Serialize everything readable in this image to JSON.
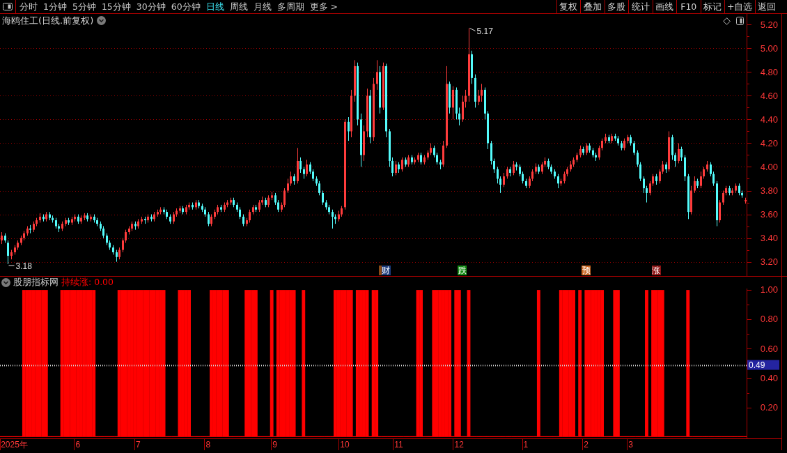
{
  "toolbar": {
    "periods": [
      {
        "label": "分时",
        "selected": false
      },
      {
        "label": "1分钟",
        "selected": false
      },
      {
        "label": "5分钟",
        "selected": false
      },
      {
        "label": "15分钟",
        "selected": false
      },
      {
        "label": "30分钟",
        "selected": false
      },
      {
        "label": "60分钟",
        "selected": false
      },
      {
        "label": "日线",
        "selected": true
      },
      {
        "label": "周线",
        "selected": false
      },
      {
        "label": "月线",
        "selected": false
      },
      {
        "label": "多周期",
        "selected": false
      },
      {
        "label": "更多 >",
        "selected": false
      }
    ],
    "actions": [
      "复权",
      "叠加",
      "多股",
      "统计",
      "画线",
      "F10",
      "标记",
      "+自选",
      "返回"
    ]
  },
  "price_pane": {
    "title": "海鸥住工(日线.前复权)",
    "events": [
      {
        "color": "#8b4a16"
      },
      {
        "label": "财",
        "color": "#1b3a7a"
      },
      {
        "label": "跌",
        "color": "#138a13"
      },
      {
        "label": "预",
        "color": "#c8641e"
      },
      {
        "label": "涨",
        "color": "#8c1414"
      }
    ],
    "chart_data": {
      "type": "candlestick",
      "ylim": [
        3.08,
        5.29
      ],
      "grid": true,
      "yticks": [
        {
          "value": 5.2,
          "label": "5.20"
        },
        {
          "value": 5.0,
          "label": "5.00"
        },
        {
          "value": 4.8,
          "label": "4.80"
        },
        {
          "value": 4.6,
          "label": "4.60"
        },
        {
          "value": 4.4,
          "label": "4.40"
        },
        {
          "value": 4.2,
          "label": "4.20"
        },
        {
          "value": 4.0,
          "label": "4.00"
        },
        {
          "value": 3.8,
          "label": "3.80"
        },
        {
          "value": 3.6,
          "label": "3.60"
        },
        {
          "value": 3.4,
          "label": "3.40"
        },
        {
          "value": 3.2,
          "label": "3.20"
        }
      ],
      "annotations": [
        "5.17",
        "3.18"
      ],
      "ohlc": [
        [
          3.38,
          3.45,
          3.35,
          3.42
        ],
        [
          3.42,
          3.44,
          3.36,
          3.38
        ],
        [
          3.36,
          3.38,
          3.18,
          3.25
        ],
        [
          3.25,
          3.3,
          3.22,
          3.28
        ],
        [
          3.28,
          3.34,
          3.26,
          3.32
        ],
        [
          3.32,
          3.38,
          3.3,
          3.36
        ],
        [
          3.36,
          3.42,
          3.34,
          3.4
        ],
        [
          3.4,
          3.46,
          3.38,
          3.44
        ],
        [
          3.44,
          3.5,
          3.42,
          3.48
        ],
        [
          3.48,
          3.51,
          3.44,
          3.47
        ],
        [
          3.47,
          3.54,
          3.45,
          3.52
        ],
        [
          3.52,
          3.57,
          3.5,
          3.55
        ],
        [
          3.55,
          3.61,
          3.53,
          3.58
        ],
        [
          3.58,
          3.6,
          3.54,
          3.56
        ],
        [
          3.56,
          3.62,
          3.54,
          3.6
        ],
        [
          3.6,
          3.62,
          3.55,
          3.57
        ],
        [
          3.57,
          3.59,
          3.53,
          3.55
        ],
        [
          3.55,
          3.57,
          3.48,
          3.5
        ],
        [
          3.5,
          3.52,
          3.45,
          3.48
        ],
        [
          3.48,
          3.54,
          3.46,
          3.52
        ],
        [
          3.52,
          3.57,
          3.5,
          3.55
        ],
        [
          3.55,
          3.57,
          3.51,
          3.53
        ],
        [
          3.53,
          3.58,
          3.51,
          3.56
        ],
        [
          3.56,
          3.6,
          3.54,
          3.58
        ],
        [
          3.58,
          3.6,
          3.52,
          3.54
        ],
        [
          3.54,
          3.59,
          3.52,
          3.57
        ],
        [
          3.57,
          3.61,
          3.55,
          3.59
        ],
        [
          3.59,
          3.61,
          3.54,
          3.56
        ],
        [
          3.56,
          3.6,
          3.54,
          3.58
        ],
        [
          3.58,
          3.6,
          3.53,
          3.55
        ],
        [
          3.55,
          3.57,
          3.5,
          3.52
        ],
        [
          3.52,
          3.54,
          3.46,
          3.48
        ],
        [
          3.48,
          3.5,
          3.4,
          3.42
        ],
        [
          3.42,
          3.44,
          3.34,
          3.36
        ],
        [
          3.36,
          3.38,
          3.3,
          3.32
        ],
        [
          3.32,
          3.34,
          3.26,
          3.28
        ],
        [
          3.28,
          3.3,
          3.2,
          3.24
        ],
        [
          3.24,
          3.32,
          3.22,
          3.3
        ],
        [
          3.3,
          3.4,
          3.28,
          3.38
        ],
        [
          3.38,
          3.47,
          3.36,
          3.45
        ],
        [
          3.45,
          3.5,
          3.43,
          3.48
        ],
        [
          3.48,
          3.54,
          3.46,
          3.52
        ],
        [
          3.52,
          3.54,
          3.47,
          3.5
        ],
        [
          3.5,
          3.56,
          3.48,
          3.54
        ],
        [
          3.54,
          3.58,
          3.52,
          3.56
        ],
        [
          3.56,
          3.58,
          3.52,
          3.55
        ],
        [
          3.55,
          3.6,
          3.53,
          3.58
        ],
        [
          3.58,
          3.6,
          3.54,
          3.56
        ],
        [
          3.56,
          3.62,
          3.54,
          3.6
        ],
        [
          3.6,
          3.64,
          3.58,
          3.62
        ],
        [
          3.62,
          3.66,
          3.6,
          3.64
        ],
        [
          3.64,
          3.66,
          3.6,
          3.62
        ],
        [
          3.62,
          3.64,
          3.56,
          3.58
        ],
        [
          3.58,
          3.6,
          3.52,
          3.54
        ],
        [
          3.54,
          3.62,
          3.52,
          3.6
        ],
        [
          3.6,
          3.65,
          3.58,
          3.63
        ],
        [
          3.63,
          3.67,
          3.61,
          3.65
        ],
        [
          3.65,
          3.67,
          3.6,
          3.62
        ],
        [
          3.62,
          3.68,
          3.6,
          3.66
        ],
        [
          3.66,
          3.7,
          3.64,
          3.68
        ],
        [
          3.68,
          3.7,
          3.64,
          3.66
        ],
        [
          3.66,
          3.72,
          3.64,
          3.7
        ],
        [
          3.7,
          3.72,
          3.65,
          3.67
        ],
        [
          3.67,
          3.69,
          3.62,
          3.64
        ],
        [
          3.64,
          3.66,
          3.58,
          3.6
        ],
        [
          3.6,
          3.62,
          3.5,
          3.52
        ],
        [
          3.52,
          3.6,
          3.5,
          3.58
        ],
        [
          3.58,
          3.64,
          3.56,
          3.62
        ],
        [
          3.62,
          3.68,
          3.6,
          3.66
        ],
        [
          3.66,
          3.68,
          3.62,
          3.64
        ],
        [
          3.64,
          3.7,
          3.62,
          3.68
        ],
        [
          3.68,
          3.72,
          3.66,
          3.7
        ],
        [
          3.7,
          3.74,
          3.68,
          3.72
        ],
        [
          3.72,
          3.74,
          3.66,
          3.68
        ],
        [
          3.68,
          3.7,
          3.62,
          3.64
        ],
        [
          3.64,
          3.66,
          3.56,
          3.58
        ],
        [
          3.58,
          3.6,
          3.5,
          3.52
        ],
        [
          3.52,
          3.57,
          3.5,
          3.55
        ],
        [
          3.55,
          3.64,
          3.53,
          3.62
        ],
        [
          3.62,
          3.68,
          3.6,
          3.66
        ],
        [
          3.66,
          3.68,
          3.62,
          3.64
        ],
        [
          3.64,
          3.72,
          3.62,
          3.7
        ],
        [
          3.7,
          3.75,
          3.68,
          3.72
        ],
        [
          3.72,
          3.74,
          3.66,
          3.68
        ],
        [
          3.68,
          3.76,
          3.66,
          3.74
        ],
        [
          3.74,
          3.79,
          3.72,
          3.76
        ],
        [
          3.76,
          3.78,
          3.68,
          3.7
        ],
        [
          3.7,
          3.72,
          3.62,
          3.64
        ],
        [
          3.64,
          3.7,
          3.62,
          3.68
        ],
        [
          3.68,
          3.82,
          3.66,
          3.8
        ],
        [
          3.8,
          3.9,
          3.78,
          3.86
        ],
        [
          3.86,
          3.96,
          3.84,
          3.92
        ],
        [
          3.92,
          3.94,
          3.85,
          3.88
        ],
        [
          3.88,
          4.16,
          3.86,
          4.05
        ],
        [
          4.05,
          4.08,
          3.95,
          3.98
        ],
        [
          3.98,
          4.0,
          3.9,
          3.94
        ],
        [
          3.94,
          4.06,
          3.92,
          4.02
        ],
        [
          4.02,
          4.04,
          3.94,
          3.96
        ],
        [
          3.96,
          3.98,
          3.88,
          3.9
        ],
        [
          3.9,
          3.92,
          3.84,
          3.86
        ],
        [
          3.86,
          3.88,
          3.76,
          3.78
        ],
        [
          3.78,
          3.8,
          3.68,
          3.7
        ],
        [
          3.7,
          3.72,
          3.64,
          3.66
        ],
        [
          3.66,
          3.68,
          3.6,
          3.62
        ],
        [
          3.62,
          3.64,
          3.48,
          3.58
        ],
        [
          3.58,
          3.6,
          3.52,
          3.56
        ],
        [
          3.56,
          3.63,
          3.54,
          3.6
        ],
        [
          3.6,
          3.67,
          3.58,
          3.65
        ],
        [
          3.66,
          4.4,
          3.64,
          4.38
        ],
        [
          4.38,
          4.42,
          4.22,
          4.3
        ],
        [
          4.3,
          4.65,
          4.25,
          4.6
        ],
        [
          4.6,
          4.9,
          4.55,
          4.85
        ],
        [
          4.85,
          4.88,
          4.35,
          4.4
        ],
        [
          4.4,
          4.45,
          4.0,
          4.1
        ],
        [
          4.1,
          4.35,
          4.05,
          4.3
        ],
        [
          4.3,
          4.66,
          4.25,
          4.6
        ],
        [
          4.6,
          4.65,
          4.2,
          4.25
        ],
        [
          4.25,
          4.75,
          4.22,
          4.7
        ],
        [
          4.7,
          4.9,
          4.65,
          4.8
        ],
        [
          4.8,
          4.85,
          4.45,
          4.5
        ],
        [
          4.5,
          4.88,
          4.48,
          4.85
        ],
        [
          4.85,
          4.87,
          4.25,
          4.3
        ],
        [
          4.3,
          4.32,
          4.0,
          4.05
        ],
        [
          4.05,
          4.08,
          3.92,
          3.95
        ],
        [
          3.95,
          4.05,
          3.93,
          4.02
        ],
        [
          4.02,
          4.04,
          3.95,
          3.98
        ],
        [
          3.98,
          4.08,
          3.96,
          4.06
        ],
        [
          4.06,
          4.08,
          4.0,
          4.02
        ],
        [
          4.02,
          4.1,
          4.0,
          4.08
        ],
        [
          4.08,
          4.1,
          4.02,
          4.04
        ],
        [
          4.04,
          4.08,
          4.02,
          4.06
        ],
        [
          4.06,
          4.12,
          4.04,
          4.1
        ],
        [
          4.1,
          4.12,
          4.02,
          4.04
        ],
        [
          4.04,
          4.1,
          4.02,
          4.08
        ],
        [
          4.08,
          4.14,
          4.06,
          4.12
        ],
        [
          4.12,
          4.2,
          4.1,
          4.16
        ],
        [
          4.16,
          4.18,
          4.08,
          4.1
        ],
        [
          4.1,
          4.12,
          4.02,
          4.04
        ],
        [
          4.04,
          4.06,
          3.98,
          4.02
        ],
        [
          4.02,
          4.22,
          4.0,
          4.18
        ],
        [
          4.18,
          4.85,
          4.16,
          4.7
        ],
        [
          4.7,
          4.72,
          4.45,
          4.5
        ],
        [
          4.5,
          4.68,
          4.4,
          4.65
        ],
        [
          4.65,
          4.67,
          4.4,
          4.45
        ],
        [
          4.45,
          4.5,
          4.35,
          4.4
        ],
        [
          4.4,
          4.6,
          4.38,
          4.55
        ],
        [
          4.55,
          4.65,
          4.5,
          4.6
        ],
        [
          4.6,
          5.17,
          4.55,
          4.95
        ],
        [
          4.95,
          4.98,
          4.7,
          4.75
        ],
        [
          4.75,
          4.78,
          4.5,
          4.55
        ],
        [
          4.55,
          4.65,
          4.52,
          4.6
        ],
        [
          4.6,
          4.7,
          4.55,
          4.65
        ],
        [
          4.65,
          4.67,
          4.4,
          4.45
        ],
        [
          4.45,
          4.47,
          4.15,
          4.2
        ],
        [
          4.2,
          4.22,
          4.02,
          4.05
        ],
        [
          4.05,
          4.07,
          3.95,
          3.98
        ],
        [
          3.98,
          4.0,
          3.86,
          3.9
        ],
        [
          3.9,
          3.92,
          3.78,
          3.85
        ],
        [
          3.85,
          3.95,
          3.83,
          3.92
        ],
        [
          3.92,
          4.0,
          3.9,
          3.98
        ],
        [
          3.98,
          4.0,
          3.92,
          3.95
        ],
        [
          3.95,
          4.05,
          3.93,
          4.02
        ],
        [
          4.02,
          4.04,
          3.97,
          4.0
        ],
        [
          4.0,
          4.02,
          3.92,
          3.94
        ],
        [
          3.94,
          3.96,
          3.86,
          3.88
        ],
        [
          3.88,
          3.9,
          3.82,
          3.84
        ],
        [
          3.84,
          3.92,
          3.82,
          3.9
        ],
        [
          3.9,
          3.98,
          3.88,
          3.96
        ],
        [
          3.96,
          4.03,
          3.94,
          4.0
        ],
        [
          4.0,
          4.02,
          3.94,
          3.96
        ],
        [
          3.96,
          4.04,
          3.94,
          4.02
        ],
        [
          4.02,
          4.08,
          4.0,
          4.05
        ],
        [
          4.05,
          4.07,
          3.98,
          4.0
        ],
        [
          4.0,
          4.02,
          3.94,
          3.96
        ],
        [
          3.96,
          3.98,
          3.9,
          3.92
        ],
        [
          3.92,
          3.94,
          3.82,
          3.86
        ],
        [
          3.86,
          3.9,
          3.84,
          3.88
        ],
        [
          3.88,
          3.96,
          3.86,
          3.94
        ],
        [
          3.94,
          4.0,
          3.92,
          3.98
        ],
        [
          3.98,
          4.05,
          3.96,
          4.02
        ],
        [
          4.02,
          4.08,
          4.0,
          4.06
        ],
        [
          4.06,
          4.12,
          4.04,
          4.1
        ],
        [
          4.1,
          4.18,
          4.08,
          4.15
        ],
        [
          4.15,
          4.17,
          4.1,
          4.12
        ],
        [
          4.12,
          4.2,
          4.1,
          4.18
        ],
        [
          4.18,
          4.2,
          4.12,
          4.14
        ],
        [
          4.14,
          4.16,
          4.08,
          4.1
        ],
        [
          4.1,
          4.12,
          4.05,
          4.08
        ],
        [
          4.08,
          4.18,
          4.06,
          4.16
        ],
        [
          4.16,
          4.24,
          4.14,
          4.22
        ],
        [
          4.22,
          4.28,
          4.2,
          4.25
        ],
        [
          4.25,
          4.27,
          4.2,
          4.22
        ],
        [
          4.22,
          4.28,
          4.2,
          4.26
        ],
        [
          4.26,
          4.28,
          4.22,
          4.24
        ],
        [
          4.24,
          4.26,
          4.18,
          4.2
        ],
        [
          4.2,
          4.22,
          4.14,
          4.16
        ],
        [
          4.16,
          4.24,
          4.14,
          4.22
        ],
        [
          4.22,
          4.27,
          4.2,
          4.25
        ],
        [
          4.25,
          4.27,
          4.18,
          4.2
        ],
        [
          4.2,
          4.22,
          4.1,
          4.12
        ],
        [
          4.12,
          4.14,
          4.0,
          4.02
        ],
        [
          4.02,
          4.04,
          3.88,
          3.9
        ],
        [
          3.9,
          3.92,
          3.78,
          3.82
        ],
        [
          3.82,
          3.84,
          3.7,
          3.78
        ],
        [
          3.78,
          3.88,
          3.76,
          3.86
        ],
        [
          3.86,
          3.94,
          3.84,
          3.92
        ],
        [
          3.92,
          3.94,
          3.85,
          3.88
        ],
        [
          3.88,
          3.98,
          3.86,
          3.96
        ],
        [
          3.96,
          4.05,
          3.94,
          4.02
        ],
        [
          4.02,
          4.04,
          3.95,
          3.98
        ],
        [
          3.98,
          4.3,
          3.96,
          4.25
        ],
        [
          4.25,
          4.27,
          4.06,
          4.1
        ],
        [
          4.1,
          4.12,
          4.0,
          4.05
        ],
        [
          4.05,
          4.2,
          4.03,
          4.15
        ],
        [
          4.15,
          4.17,
          4.05,
          4.08
        ],
        [
          4.08,
          4.1,
          3.88,
          3.92
        ],
        [
          3.92,
          3.94,
          3.56,
          3.62
        ],
        [
          3.62,
          3.84,
          3.6,
          3.8
        ],
        [
          3.8,
          3.92,
          3.78,
          3.88
        ],
        [
          3.88,
          3.9,
          3.82,
          3.84
        ],
        [
          3.84,
          3.96,
          3.82,
          3.92
        ],
        [
          3.92,
          4.0,
          3.9,
          3.98
        ],
        [
          3.98,
          4.05,
          3.96,
          4.02
        ],
        [
          4.02,
          4.04,
          3.92,
          3.94
        ],
        [
          3.94,
          3.96,
          3.84,
          3.86
        ],
        [
          3.86,
          3.88,
          3.5,
          3.55
        ],
        [
          3.55,
          3.72,
          3.53,
          3.7
        ],
        [
          3.7,
          3.8,
          3.68,
          3.78
        ],
        [
          3.78,
          3.84,
          3.76,
          3.82
        ],
        [
          3.82,
          3.84,
          3.76,
          3.78
        ],
        [
          3.78,
          3.82,
          3.76,
          3.8
        ],
        [
          3.8,
          3.86,
          3.78,
          3.84
        ],
        [
          3.84,
          3.86,
          3.76,
          3.78
        ],
        [
          3.78,
          3.8,
          3.74,
          3.76
        ],
        [
          3.71,
          3.74,
          3.69,
          3.72
        ]
      ]
    }
  },
  "indicator_pane": {
    "title": "股朋指标网",
    "readout": "持续涨: 0.00",
    "chart_data": {
      "type": "bar",
      "ylim": [
        -0.01,
        1.01
      ],
      "color": "#ff0000",
      "yticks": [
        {
          "value": 1.0,
          "label": "1.00"
        },
        {
          "value": 0.8,
          "label": "0.80"
        },
        {
          "value": 0.6,
          "label": "0.60"
        },
        {
          "value": 0.4,
          "label": "0.40"
        },
        {
          "value": 0.2,
          "label": "0.20"
        }
      ],
      "ref_lines": [
        {
          "axis": "y",
          "value": 0.49,
          "label": "0.49",
          "color": "#d8d8d8",
          "line_style": "dashed"
        }
      ],
      "categories": [
        null,
        null,
        null,
        null,
        "2025年",
        null,
        null,
        null,
        null,
        null,
        null,
        null,
        null,
        null,
        null,
        null,
        null,
        null,
        null,
        null,
        null,
        null,
        null,
        null,
        "6",
        null,
        null,
        null,
        null,
        null,
        null,
        null,
        null,
        null,
        null,
        null,
        null,
        null,
        null,
        null,
        null,
        null,
        null,
        "7",
        null,
        null,
        null,
        null,
        null,
        null,
        null,
        null,
        null,
        null,
        null,
        null,
        null,
        null,
        null,
        null,
        null,
        null,
        null,
        null,
        null,
        "8",
        null,
        null,
        null,
        null,
        null,
        null,
        null,
        null,
        null,
        null,
        null,
        null,
        null,
        null,
        null,
        null,
        null,
        null,
        null,
        null,
        "9",
        null,
        null,
        null,
        null,
        null,
        null,
        null,
        null,
        null,
        null,
        null,
        null,
        null,
        null,
        null,
        null,
        null,
        null,
        null,
        null,
        null,
        "10",
        null,
        null,
        null,
        null,
        null,
        null,
        null,
        null,
        null,
        null,
        null,
        null,
        null,
        null,
        null,
        null,
        "11",
        null,
        null,
        null,
        null,
        null,
        null,
        null,
        null,
        null,
        null,
        null,
        null,
        null,
        null,
        null,
        null,
        null,
        null,
        "12",
        null,
        null,
        null,
        null,
        null,
        null,
        null,
        null,
        null,
        null,
        null,
        null,
        null,
        null,
        null,
        null,
        null,
        null,
        null,
        null,
        "1",
        null,
        null,
        null,
        null,
        null,
        null,
        null,
        null,
        null,
        null,
        null,
        null,
        null,
        null,
        null,
        null,
        null,
        null,
        "2",
        null,
        null,
        null,
        null,
        null,
        null,
        null,
        null,
        null,
        null,
        null,
        null,
        null,
        "3",
        null,
        null,
        null,
        null,
        null,
        null,
        null,
        null,
        null,
        null,
        null,
        null,
        null,
        null,
        null,
        null,
        null,
        null,
        null,
        null,
        null,
        null,
        null,
        null,
        null,
        null,
        null,
        null,
        null,
        null,
        null,
        null,
        null,
        null,
        null,
        null
      ],
      "values": [
        0,
        0,
        0,
        0,
        0,
        0,
        0,
        1,
        1,
        1,
        1,
        1,
        1,
        1,
        1,
        0,
        0,
        0,
        0,
        1,
        1,
        1,
        1,
        1,
        1,
        1,
        1,
        1,
        1,
        1,
        0,
        0,
        0,
        0,
        0,
        0,
        0,
        1,
        1,
        1,
        1,
        1,
        1,
        1,
        1,
        1,
        1,
        1,
        1,
        1,
        1,
        1,
        0,
        0,
        0,
        0,
        1,
        1,
        1,
        1,
        0,
        0,
        0,
        0,
        0,
        0,
        1,
        1,
        1,
        1,
        1,
        1,
        0,
        0,
        0,
        0,
        0,
        1,
        1,
        1,
        1,
        0,
        0,
        0,
        0,
        1,
        0,
        1,
        1,
        1,
        1,
        1,
        1,
        0,
        0,
        1,
        0,
        0,
        0,
        0,
        0,
        0,
        0,
        0,
        0,
        1,
        1,
        1,
        1,
        1,
        1,
        0,
        1,
        1,
        1,
        1,
        0,
        1,
        1,
        0,
        0,
        0,
        0,
        0,
        0,
        0,
        0,
        0,
        0,
        0,
        0,
        1,
        1,
        0,
        0,
        0,
        1,
        1,
        1,
        1,
        1,
        1,
        0,
        1,
        1,
        0,
        0,
        1,
        0,
        0,
        0,
        0,
        0,
        0,
        0,
        0,
        0,
        0,
        0,
        0,
        0,
        0,
        0,
        0,
        0,
        0,
        0,
        0,
        0,
        1,
        0,
        0,
        0,
        0,
        0,
        0,
        1,
        1,
        1,
        1,
        1,
        0,
        1,
        0,
        1,
        1,
        1,
        1,
        1,
        1,
        0,
        0,
        0,
        1,
        1,
        0,
        0,
        0,
        0,
        0,
        0,
        0,
        0,
        1,
        0,
        1,
        1,
        1,
        1,
        0,
        0,
        0,
        0,
        0,
        0,
        0,
        1,
        0,
        0,
        0,
        0,
        0,
        0,
        0,
        0,
        0,
        0,
        0,
        0,
        0,
        0,
        0,
        0,
        0,
        0
      ]
    }
  }
}
